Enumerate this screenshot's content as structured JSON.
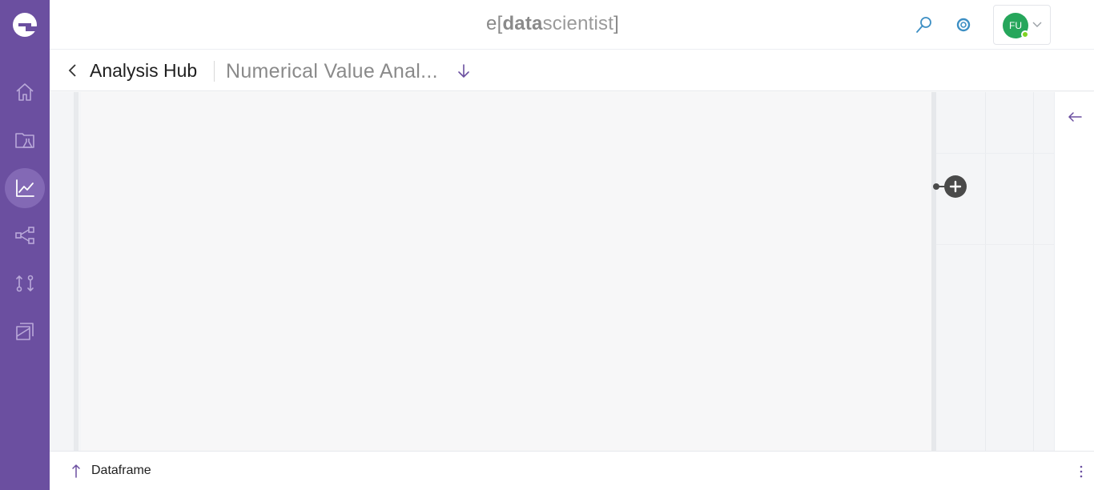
{
  "app": {
    "brand_prefix": "e",
    "brand_open": "[",
    "brand_bold": "data",
    "brand_light": "scientist",
    "brand_close": "]"
  },
  "colors": {
    "sidebar_bg": "#6b4fa0",
    "sidebar_active": "#8369b5",
    "accent_blue": "#3d8fc4",
    "avatar_bg": "#26a65b",
    "status_online": "#7ed321"
  },
  "sidebar": {
    "items": [
      {
        "name": "home",
        "icon": "home-icon"
      },
      {
        "name": "projects",
        "icon": "folder-flask-icon"
      },
      {
        "name": "analysis-hub",
        "icon": "line-chart-icon",
        "active": true
      },
      {
        "name": "workflows",
        "icon": "share-nodes-icon"
      },
      {
        "name": "pipelines",
        "icon": "compare-arrows-icon"
      },
      {
        "name": "reports",
        "icon": "stacked-cards-icon"
      }
    ]
  },
  "header": {
    "search_icon": "search-icon",
    "help_icon": "lifebuoy-icon",
    "user_initials": "FU",
    "user_status": "online"
  },
  "breadcrumb": {
    "title": "Analysis Hub",
    "subtitle": "Numerical Value Anal..."
  },
  "bottom": {
    "label": "Dataframe"
  }
}
